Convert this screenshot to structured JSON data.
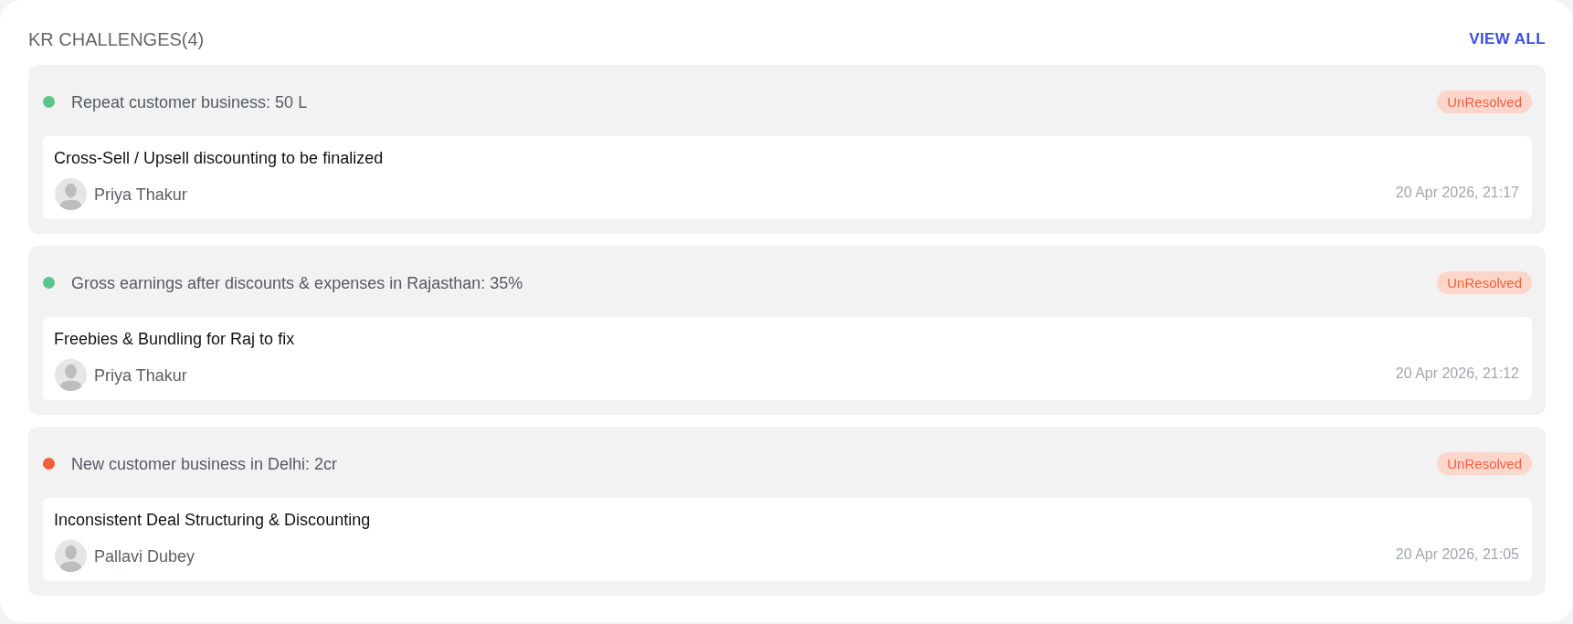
{
  "header": {
    "title": "KR CHALLENGES(4)",
    "view_all": "VIEW ALL"
  },
  "challenges": [
    {
      "key_result": "Repeat customer business: 50 L",
      "color": "#5bc48d",
      "status": "UnResolved",
      "title": "Cross-Sell / Upsell discounting to be finalized",
      "owner": "Priya Thakur",
      "timestamp": "20 Apr 2026, 21:17"
    },
    {
      "key_result": "Gross earnings after discounts & expenses in Rajasthan: 35%",
      "color": "#5bc48d",
      "status": "UnResolved",
      "title": "Freebies & Bundling for Raj to fix",
      "owner": "Priya Thakur",
      "timestamp": "20 Apr 2026, 21:12"
    },
    {
      "key_result": "New customer business in Delhi: 2cr",
      "color": "#f25f3a",
      "status": "UnResolved",
      "title": "Inconsistent Deal Structuring & Discounting",
      "owner": "Pallavi Dubey",
      "timestamp": "20 Apr 2026, 21:05"
    }
  ]
}
